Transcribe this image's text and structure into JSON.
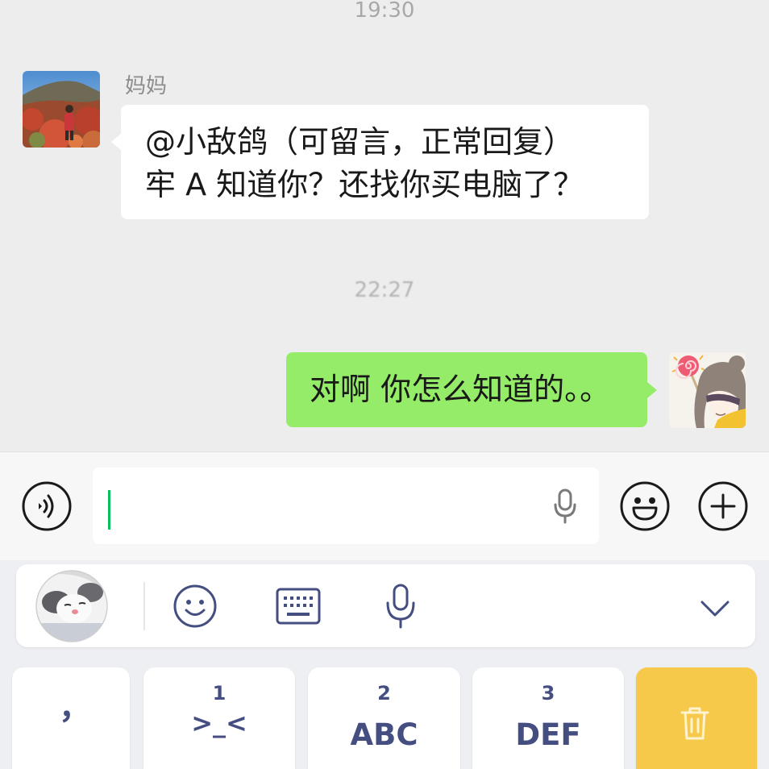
{
  "theme": {
    "chat_bg": "#EDEDED",
    "incoming_bubble": "#FFFFFF",
    "outgoing_bubble": "#95EC69",
    "cursor": "#07C160",
    "keyboard_icon": "#454E80",
    "delete_key": "#F6C94A"
  },
  "chat": {
    "time_top": "19:30",
    "incoming": {
      "sender_name": "妈妈",
      "lines": [
        "@小敌鸽（可留言，正常回复）",
        "牢 A 知道你？还找你买电脑了？"
      ]
    },
    "time_middle": "22:27",
    "outgoing": {
      "text": "对啊 你怎么知道的。。"
    }
  },
  "input_bar": {
    "voice_button_icon": "voice-icon",
    "text_input": {
      "value": ""
    },
    "input_mic_icon": "microphone-icon",
    "emoji_button_icon": "smiley-icon",
    "more_button_icon": "plus-icon"
  },
  "keyboard": {
    "toolbar": {
      "icons": [
        "smiley-icon",
        "keyboard-icon",
        "microphone-icon",
        "chevron-down-icon"
      ]
    },
    "keys": [
      {
        "label": "，"
      },
      {
        "number": "1",
        "label": ">_<"
      },
      {
        "number": "2",
        "label": "ABC"
      },
      {
        "number": "3",
        "label": "DEF"
      },
      {
        "icon": "trash-icon"
      }
    ]
  }
}
